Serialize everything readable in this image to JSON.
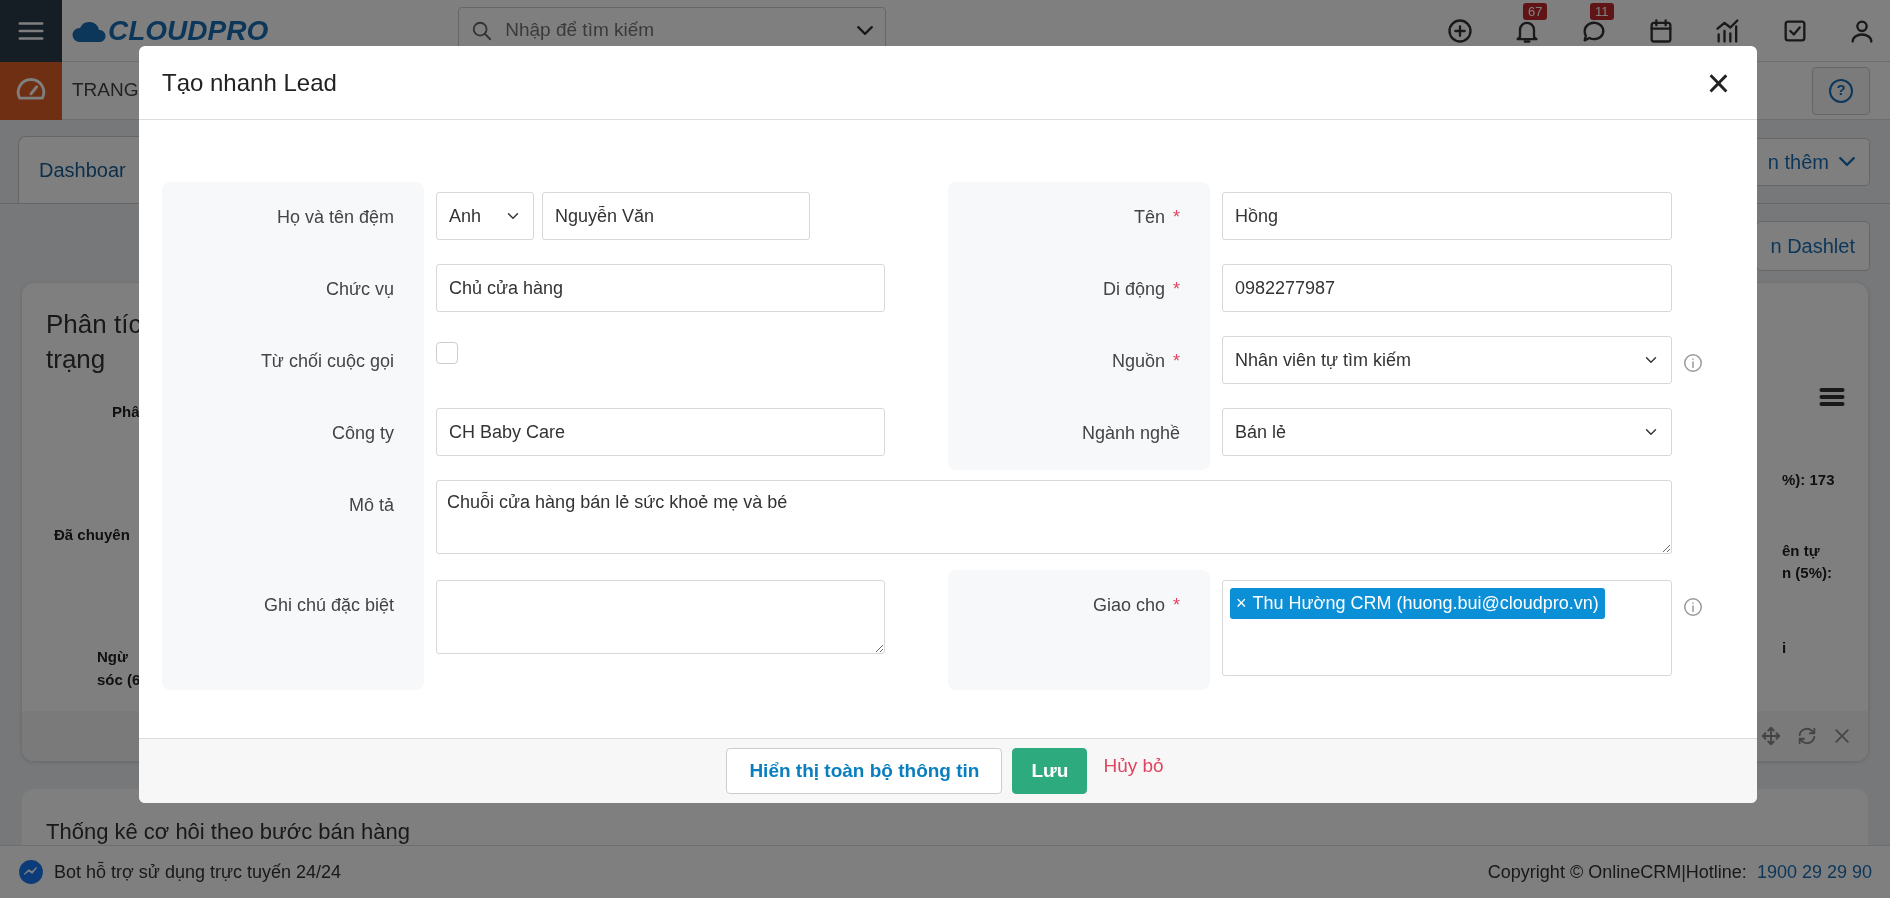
{
  "top_bar": {
    "logo": "CLOUDPRO",
    "search": {
      "placeholder": "Nhập để tìm kiếm"
    },
    "icons": [
      {
        "kind": "plus"
      },
      {
        "kind": "bell",
        "badge": "67"
      },
      {
        "kind": "chat",
        "badge": "11"
      },
      {
        "kind": "calendar"
      },
      {
        "kind": "chart"
      },
      {
        "kind": "task"
      },
      {
        "kind": "user"
      }
    ]
  },
  "page_header": {
    "title": "TRANG",
    "help": "?"
  },
  "tabs": [
    {
      "label": "Dashboar",
      "selected": true
    }
  ],
  "more_button": "n thêm",
  "add_dashlet_button": "n Dashlet",
  "dashlet": {
    "title_lines": [
      "Phân tíc",
      "trạng"
    ],
    "left_labels": [
      "Phâ",
      "Đã chuyên",
      "Ngừ",
      "sóc (6"
    ],
    "right_labels": [
      "%): 173",
      "ên tự",
      "n (5%):",
      "i"
    ]
  },
  "dashlet_2": {
    "title": "Thống kê cơ hôi theo bước bán hàng"
  },
  "status_bar": {
    "bot_text": "Bot hỗ trợ sử dụng trực tuyến 24/24",
    "copyright": "Copyright © OnlineCRM|Hotline:",
    "hotline": "1900 29 29 90"
  },
  "modal": {
    "title": "Tạo nhanh Lead",
    "close": "×",
    "rows": [
      {
        "left": {
          "label": "Họ và tên đệm",
          "kind": "name",
          "salutation": "Anh",
          "value": "Nguyễn Văn"
        },
        "right": {
          "label": "Tên",
          "kind": "text",
          "value": "Hồng",
          "required_mark": "*"
        }
      },
      {
        "left": {
          "label": "Chức vụ",
          "kind": "text",
          "value": "Chủ cửa hàng"
        },
        "right": {
          "label": "Di động",
          "kind": "text",
          "value": "0982277987",
          "required_mark": "*"
        }
      },
      {
        "left": {
          "label": "Từ chối cuộc gọi",
          "kind": "checkbox",
          "checked": false
        },
        "right": {
          "label": "Nguồn",
          "kind": "select",
          "value": "Nhân viên tự tìm kiếm",
          "required_mark": "*",
          "info": true
        }
      },
      {
        "left": {
          "label": "Công ty",
          "kind": "text",
          "value": "CH Baby Care"
        },
        "right": {
          "label": "Ngành nghề",
          "kind": "select",
          "value": "Bán lẻ"
        }
      },
      {
        "full": {
          "label": "Mô tả",
          "kind": "textarea",
          "value": "Chuỗi cửa hàng bán lẻ sức khoẻ mẹ và bé"
        }
      },
      {
        "left": {
          "label": "Ghi chú đặc biệt",
          "kind": "textarea"
        },
        "right": {
          "label": "Giao cho",
          "kind": "tags",
          "tags": [
            {
              "remove": "×",
              "label": "Thu Hường CRM (huong.bui@cloudpro.vn)"
            }
          ],
          "required_mark": "*",
          "info": true
        }
      }
    ],
    "buttons": [
      {
        "label": "Hiển thị toàn bộ thông tin",
        "kind": "outline"
      },
      {
        "label": "Lưu",
        "kind": "primary"
      },
      {
        "label": "Hủy bỏ",
        "kind": "link"
      }
    ]
  }
}
